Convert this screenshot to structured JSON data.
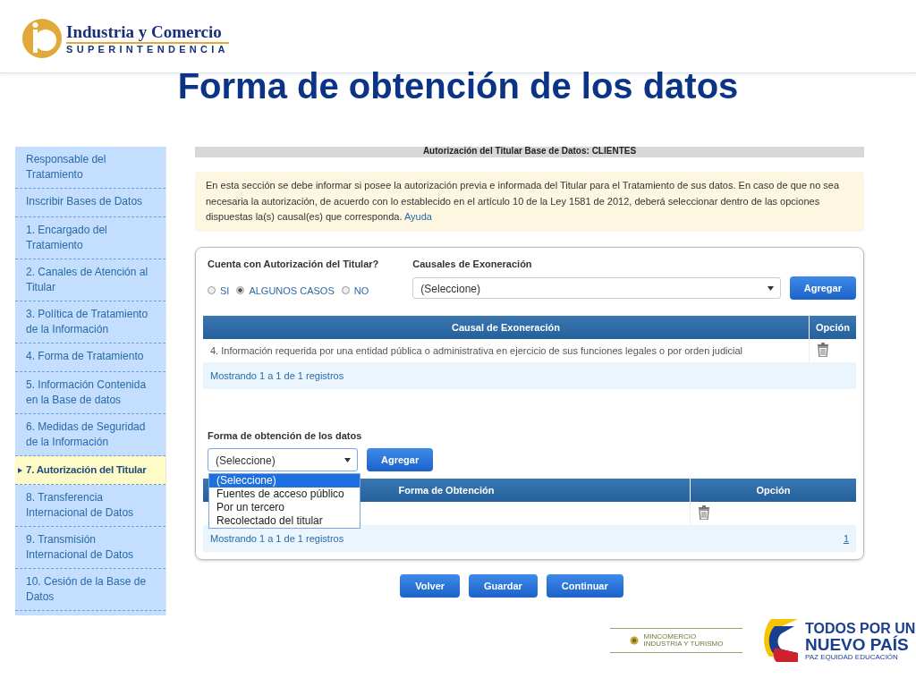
{
  "logo": {
    "name": "Industria y Comercio",
    "subtitle": "SUPERINTENDENCIA"
  },
  "title": "Forma de obtención de los datos",
  "sidebar": {
    "items": [
      {
        "label": "Responsable del Tratamiento",
        "selected": false
      },
      {
        "label": "Inscribir Bases de Datos",
        "selected": false
      },
      {
        "label": "1. Encargado del Tratamiento",
        "selected": false
      },
      {
        "label": "2. Canales de Atención al Titular",
        "selected": false
      },
      {
        "label": "3. Política de Tratamiento de la Información",
        "selected": false
      },
      {
        "label": "4. Forma de Tratamiento",
        "selected": false
      },
      {
        "label": "5. Información Contenida en la Base de datos",
        "selected": false
      },
      {
        "label": "6. Medidas de Seguridad de la Información",
        "selected": false
      },
      {
        "label": "7. Autorización del Titular",
        "selected": true
      },
      {
        "label": "8. Transferencia Internacional de Datos",
        "selected": false
      },
      {
        "label": "9. Transmisión Internacional de Datos",
        "selected": false
      },
      {
        "label": "10. Cesión de la Base de Datos",
        "selected": false
      }
    ]
  },
  "section_header": "Autorización del Titular Base de Datos: CLIENTES",
  "info": {
    "text": "En esta sección se debe informar si posee la autorización previa e informada del Titular para el Tratamiento de sus datos. En caso de que no sea necesaria la autorización, de acuerdo con lo establecido en el artículo 10 de la Ley 1581 de 2012, deberá seleccionar dentro de las opciones dispuestas la(s) causal(es) que corresponda.",
    "link": "Ayuda"
  },
  "authorization": {
    "label": "Cuenta con Autorización del Titular?",
    "options": [
      {
        "label": "SI",
        "selected": false
      },
      {
        "label": "ALGUNOS CASOS",
        "selected": true
      },
      {
        "label": "NO",
        "selected": false
      }
    ]
  },
  "causales": {
    "label": "Causales de Exoneración",
    "select_value": "(Seleccione)",
    "button": "Agregar",
    "columns": [
      "Causal de Exoneración",
      "Opción"
    ],
    "rows": [
      "4. Información requerida por una entidad pública o administrativa en ejercicio de sus funciones legales o por orden judicial"
    ],
    "footer": "Mostrando 1 a 1 de 1 registros"
  },
  "forma": {
    "label": "Forma de obtención de los datos",
    "select_value": "(Seleccione)",
    "button": "Agregar",
    "dropdown_options": [
      {
        "label": "(Seleccione)",
        "selected": true
      },
      {
        "label": "Fuentes de acceso público",
        "selected": false
      },
      {
        "label": "Por un tercero",
        "selected": false
      },
      {
        "label": "Recolectado del titular",
        "selected": false
      }
    ],
    "columns": [
      "Forma de Obtención",
      "Opción"
    ],
    "footer": "Mostrando 1 a 1 de 1 registros",
    "page": "1"
  },
  "buttons": [
    "Volver",
    "Guardar",
    "Continuar"
  ],
  "footer_logos": {
    "ministry": [
      "MINCOMERCIO",
      "INDUSTRIA Y TURISMO"
    ],
    "slogan": [
      "TODOS POR UN",
      "NUEVO PAÍS"
    ],
    "slogan_sub": "PAZ  EQUIDAD  EDUCACIÓN"
  }
}
